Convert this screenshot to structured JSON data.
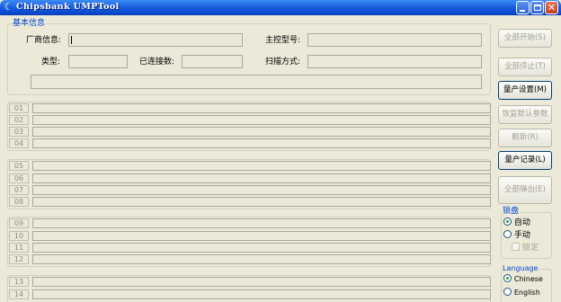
{
  "window": {
    "title": "Chipsbank UMPTool",
    "app_icon": "chipsbank-c-icon",
    "controls": [
      "minimize-icon",
      "maximize-icon",
      "close-icon"
    ]
  },
  "basic_info": {
    "group_title": "基本信息",
    "vendor_label": "厂商信息:",
    "vendor_value": "",
    "controller_label": "主控型号:",
    "controller_value": "",
    "type_label": "类型:",
    "type_value": "",
    "connected_label": "已连接数:",
    "connected_value": "",
    "scan_label": "扫描方式:",
    "scan_value": "",
    "status_value": ""
  },
  "ports": {
    "group1": [
      "01",
      "02",
      "03",
      "04"
    ],
    "group2": [
      "05",
      "06",
      "07",
      "08"
    ],
    "group3": [
      "09",
      "10",
      "11",
      "12"
    ],
    "group4": [
      "13",
      "14"
    ]
  },
  "buttons": {
    "start_all": "全部开始(S)",
    "stop_all": "全部停止(T)",
    "mp_settings": "量产设置(M)",
    "restore_default": "恢复默认参数",
    "refresh": "刷新(R)",
    "mp_log": "量产记录(L)",
    "eject_all": "全部弹出(E)"
  },
  "lock_disk": {
    "group_title": "锁盘",
    "auto": "自动",
    "manual": "手动",
    "lock": "锁定",
    "selected": "auto"
  },
  "language": {
    "group_title": "Language",
    "chinese": "Chinese",
    "english": "English",
    "selected": "Chinese"
  }
}
